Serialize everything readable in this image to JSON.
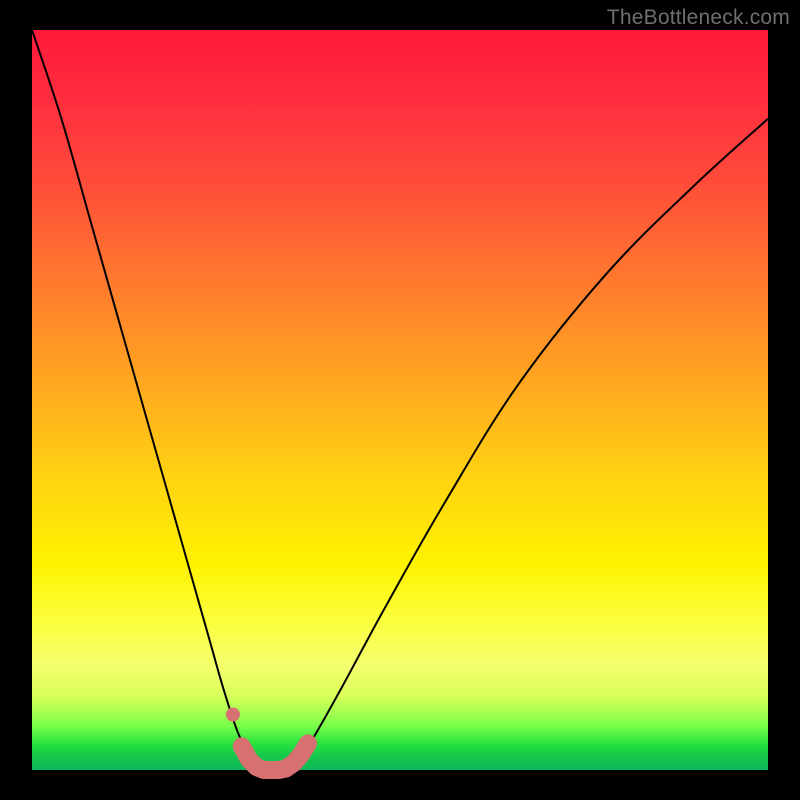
{
  "watermark": "TheBottleneck.com",
  "colors": {
    "frame": "#000000",
    "curve": "#000000",
    "marker": "#d77070",
    "watermark": "#6f6f6f"
  },
  "chart_data": {
    "type": "line",
    "title": "",
    "xlabel": "",
    "ylabel": "",
    "xlim": [
      0,
      100
    ],
    "ylim": [
      0,
      100
    ],
    "series": [
      {
        "name": "bottleneck-curve",
        "x": [
          0,
          4,
          8,
          12,
          16,
          20,
          24,
          26,
          28,
          30,
          31,
          32,
          33,
          34,
          35,
          36,
          38,
          42,
          48,
          56,
          66,
          78,
          90,
          100
        ],
        "y": [
          100,
          88,
          74,
          60,
          46,
          32,
          18,
          11,
          5,
          1,
          0,
          0,
          0,
          0,
          0.5,
          1.5,
          4,
          11,
          22,
          36,
          52,
          67,
          79,
          88
        ]
      }
    ],
    "markers": {
      "name": "highlight-band",
      "x": [
        28.5,
        29.5,
        30.5,
        31.5,
        32.5,
        33.5,
        34.5,
        35.5,
        36.5,
        37.5
      ],
      "y": [
        3.2,
        1.4,
        0.4,
        0,
        0,
        0,
        0.2,
        0.9,
        2.0,
        3.6
      ]
    },
    "isolated_marker": {
      "x": 27.3,
      "y": 7.5
    }
  }
}
